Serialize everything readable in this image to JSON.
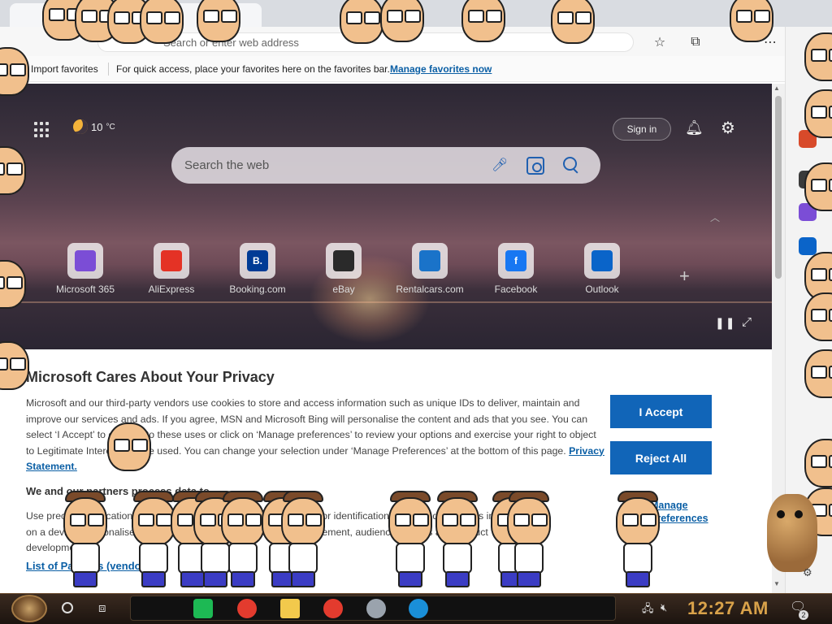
{
  "browser": {
    "address_placeholder": "Search or enter web address",
    "toolbar_icons": [
      "favorites-icon",
      "collections-icon",
      "more-icon"
    ]
  },
  "favbar": {
    "import_label": "Import favorites",
    "hint_text": "For quick access, place your favorites here on the favorites bar.",
    "manage_link": "Manage favorites now"
  },
  "newtab": {
    "weather_temp": "10",
    "weather_unit": "°C",
    "sign_in_label": "Sign in",
    "search_placeholder": "Search the web",
    "tiles": [
      {
        "label": "Microsoft 365",
        "icon": "m365-icon",
        "color": "#7b4dd6"
      },
      {
        "label": "AliExpress",
        "icon": "aliexpress-icon",
        "color": "#e43225"
      },
      {
        "label": "Booking.com",
        "icon": "booking-icon",
        "color": "#003b95"
      },
      {
        "label": "eBay",
        "icon": "ebay-icon",
        "color": "#2a2a2a"
      },
      {
        "label": "Rentalcars.com",
        "icon": "rentalcars-icon",
        "color": "#1a73c9"
      },
      {
        "label": "Facebook",
        "icon": "facebook-icon",
        "color": "#1877f2"
      },
      {
        "label": "Outlook",
        "icon": "outlook-icon",
        "color": "#0a64c9"
      }
    ],
    "tile_logo_text": {
      "booking": "B.",
      "facebook": "f"
    }
  },
  "privacy": {
    "title": "Microsoft Cares About Your Privacy",
    "body_line_1": "Microsoft and our third-party vendors use cookies to store and access information such as unique IDs to deliver, maintain and",
    "body_line_2": "improve our services and ads. If you agree, MSN and Microsoft Bing will personalise the content and ads that you see. You can",
    "body_line_3": "select ‘I Accept’ to consent to these uses or click on ‘Manage preferences’ to review your options and exercise your right to object",
    "body_line_4": "to Legitimate Interests where used. You can change your selection under ‘Manage Preferences’ at the bottom of this page.",
    "privacy_link": "Privacy Statement.",
    "partners_heading": "We and our partners process data to",
    "partners_line_1": "Use precise geolocation data. Actively scan device characteristics for identification. Store and/or access information",
    "partners_line_2": "on a device. Personalised ads and content, ad and content measurement, audience insights and product",
    "partners_line_3": "development.",
    "vendors_link": "List of Partners (vendors)",
    "manage_link_1": "Manage",
    "manage_link_2": "Preferences",
    "accept_label": "I Accept",
    "reject_label": "Reject All"
  },
  "taskbar": {
    "clock": "12:27 AM",
    "notification_count": "2",
    "pinned_apps": [
      "spotify-icon",
      "chrome-icon",
      "file-explorer-icon",
      "chrome-icon",
      "app-icon",
      "edge-icon"
    ]
  },
  "colors": {
    "accent": "#1165b8",
    "link": "#0b5fa5",
    "clock": "#d9a24a"
  }
}
